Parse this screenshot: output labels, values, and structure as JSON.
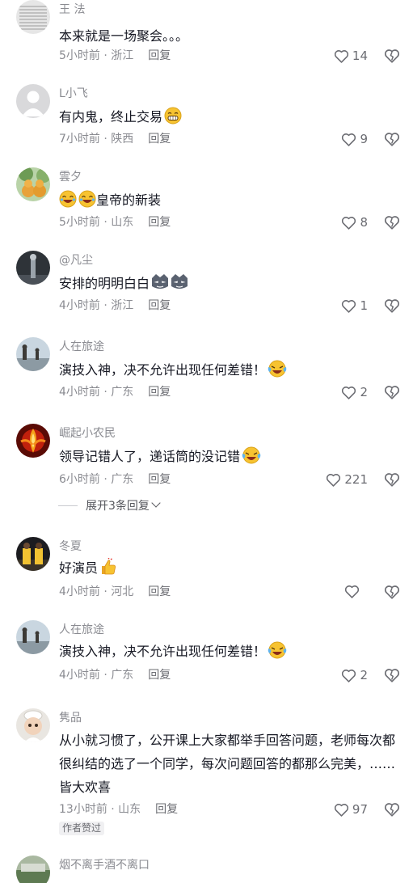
{
  "comments": [
    {
      "user": "王                法",
      "text": "本来就是一场聚会。。。",
      "emoji": "",
      "time_loc": "5小时前 · 浙江",
      "reply": "回复",
      "likes": "14"
    },
    {
      "user": "L小飞",
      "text": "有内鬼，终止交易",
      "emoji": "grin",
      "time_loc": "7小时前 · 陕西",
      "reply": "回复",
      "likes": "9"
    },
    {
      "user": "雲夕",
      "text": "皇帝的新装",
      "emoji": "laugh2-prefix",
      "time_loc": "5小时前 · 山东",
      "reply": "回复",
      "likes": "8"
    },
    {
      "user": "@凡尘",
      "text": "安排的明明白白",
      "emoji": "sly2",
      "time_loc": "4小时前 · 浙江",
      "reply": "回复",
      "likes": "1"
    },
    {
      "user": "人在旅途",
      "text": "演技入神，决不允许出现任何差错！",
      "emoji": "cry-laugh",
      "time_loc": "4小时前 · 广东",
      "reply": "回复",
      "likes": "2"
    },
    {
      "user": "崛起小农民",
      "text": "领导记错人了，递话筒的没记错",
      "emoji": "cry-laugh",
      "time_loc": "6小时前 · 广东",
      "reply": "回复",
      "likes": "221"
    },
    {
      "user": "冬夏",
      "text": "好演员",
      "emoji": "thumbs-up",
      "time_loc": "4小时前 · 河北",
      "reply": "回复",
      "likes": ""
    },
    {
      "user": "人在旅途",
      "text": "演技入神，决不允许出现任何差错！",
      "emoji": "cry-laugh",
      "time_loc": "4小时前 · 广东",
      "reply": "回复",
      "likes": "2"
    },
    {
      "user": "隽品",
      "text": "从小就习惯了，公开课上大家都举手回答问题，老师每次都很纠结的选了一个同学，每次问题回答的都那么完美，……皆大欢喜",
      "emoji": "",
      "time_loc": "13小时前 · 山东",
      "reply": "回复",
      "likes": "97"
    },
    {
      "user": "烟不离手酒不离口",
      "text": "",
      "emoji": "",
      "time_loc": "",
      "reply": "",
      "likes": ""
    }
  ],
  "expand_replies": "展开3条回复",
  "author_liked": "作者赞过",
  "colors": {
    "text": "#161823",
    "meta": "#8a8b91",
    "background": "#ffffff",
    "emoji_yellow": "#f7c331"
  }
}
